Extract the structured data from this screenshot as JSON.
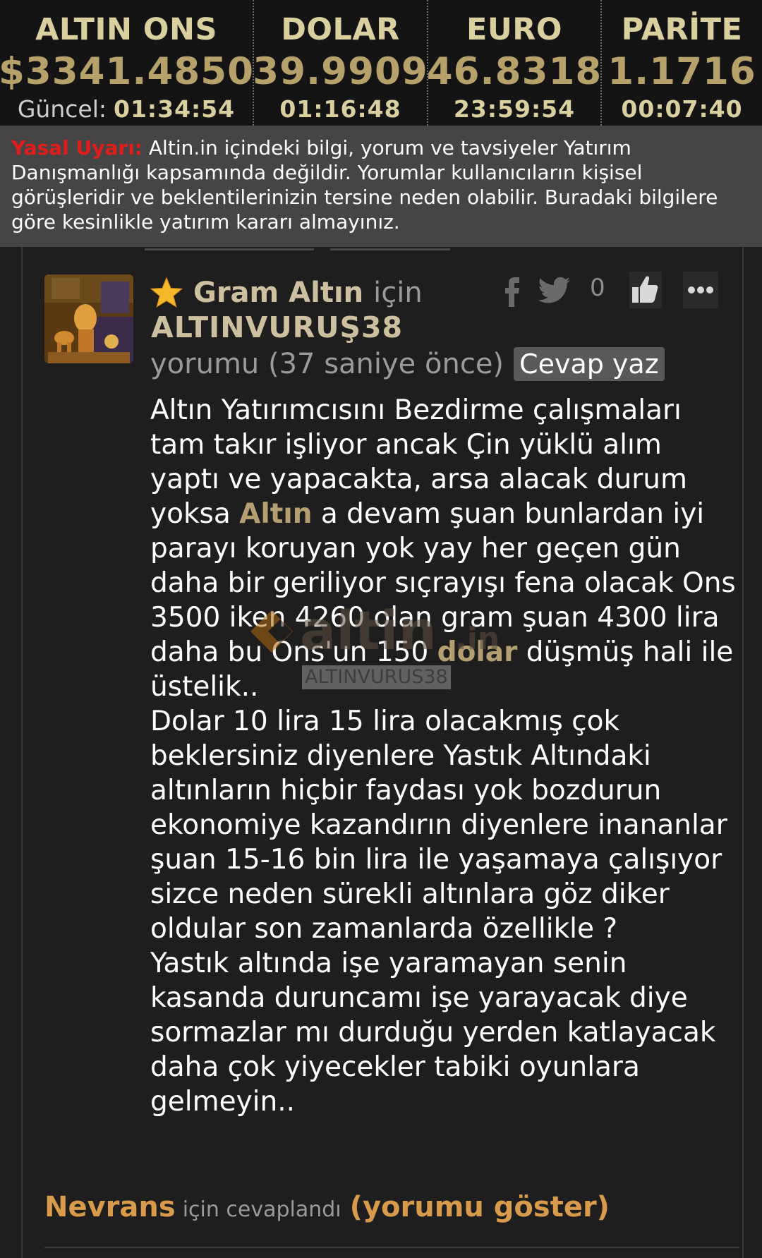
{
  "ticker": [
    {
      "name": "ALTIN ONS",
      "value": "$3341.4850",
      "updated_label": "Güncel:",
      "time": "01:34:54"
    },
    {
      "name": "DOLAR",
      "value": "39.9909",
      "time": "01:16:48"
    },
    {
      "name": "EURO",
      "value": "46.8318",
      "time": "23:59:54"
    },
    {
      "name": "PARİTE",
      "value": "1.1716",
      "time": "00:07:40"
    }
  ],
  "warning": {
    "label": "Yasal Uyarı:",
    "text": " Altin.in içindeki bilgi, yorum ve tavsiyeler Yatırım Danışmanlığı kapsamında değildir. Yorumlar kullanıcıların kişisel görüşleridir ve beklentilerinizin tersine neden olabilir. Buradaki bilgilere göre kesinlikle yatırım kararı almayınız."
  },
  "comment": {
    "topic": "Gram Altın",
    "for_word": "için",
    "username": "ALTINVURUŞ38",
    "meta": "yorumu (37 saniye önce)",
    "reply_button": "Cevap yaz",
    "likes": "0",
    "body_segments": [
      "Altın Yatırımcısını Bezdirme çalışmaları tam takır işliyor ancak Çin yüklü alım yaptı ve yapacakta, arsa alacak durum yoksa ",
      "Altın",
      " a devam şuan bunlardan iyi parayı koruyan yok yay her geçen gün daha bir geriliyor sıçrayışı fena olacak Ons 3500 iken 4260 olan gram şuan 4300 lira daha bu Ons'un 150 ",
      "dolar",
      " düşmüş hali ile üstelik.."
    ],
    "body_paragraph_2": "Dolar 10 lira 15 lira olacakmış çok beklersiniz diyenlere Yastık Altındaki altınların hiçbir faydası yok bozdurun ekonomiye kazandırın diyenlere inananlar şuan 15-16 bin lira ile yaşamaya çalışıyor sizce neden sürekli altınlara göz diker oldular son zamanlarda özellikle ?",
    "body_paragraph_3": "Yastık altında işe yaramayan senin kasanda duruncamı işe yarayacak diye sormazlar mı durduğu yerden katlayacak daha çok yiyecekler tabiki oyunlara gelmeyin.."
  },
  "watermark": {
    "brand": "altin",
    "tld": ".in",
    "username": "ALTINVURUS38"
  },
  "reply_info": {
    "user": "Nevrans",
    "text": "için cevaplandı",
    "link": "(yorumu göster)"
  },
  "colors": {
    "ticker_bg": "#141414",
    "gold_text": "#b6a16a",
    "gold_label": "#d9cf9f",
    "warning_bg": "#454545",
    "warning_label": "#e11c1c",
    "page_bg": "#1e1e1e",
    "reply_orange": "#d79b4b"
  },
  "icons": [
    "star-icon",
    "facebook-icon",
    "twitter-icon",
    "thumbs-up-icon",
    "more-options-icon"
  ]
}
